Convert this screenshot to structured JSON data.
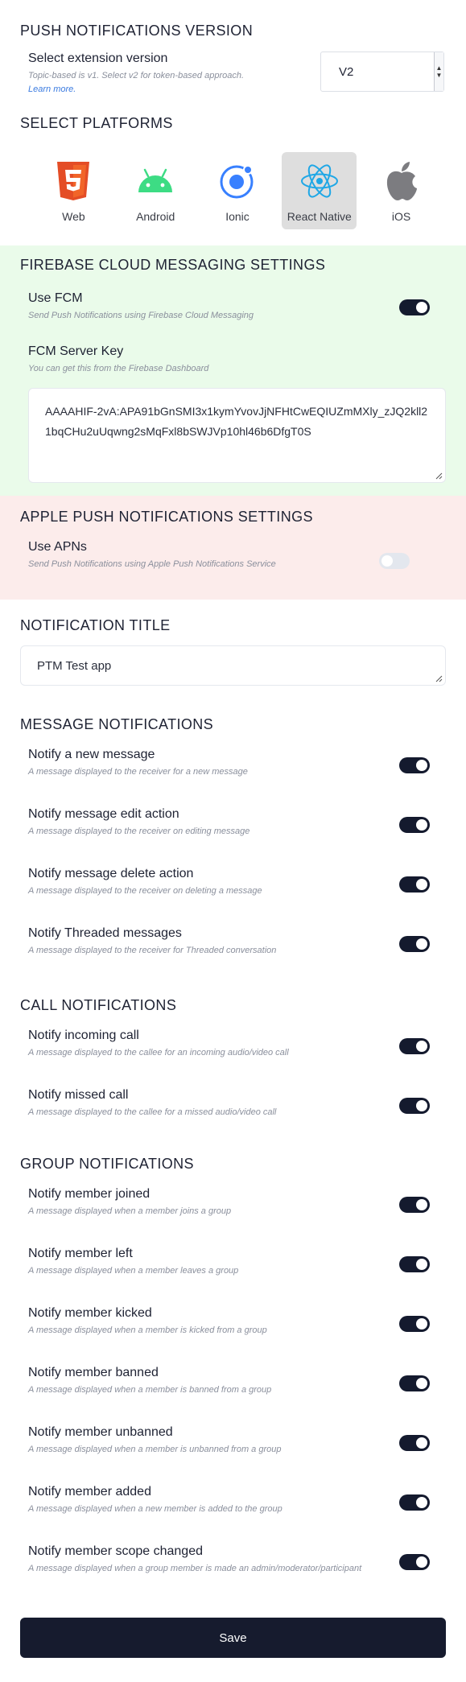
{
  "version": {
    "heading": "PUSH NOTIFICATIONS VERSION",
    "label": "Select extension version",
    "hint": "Topic-based is v1. Select v2 for token-based approach.",
    "learn_more": "Learn more.",
    "selected": "V2"
  },
  "platforms": {
    "heading": "SELECT PLATFORMS",
    "items": [
      {
        "label": "Web",
        "icon": "html5-icon",
        "selected": false
      },
      {
        "label": "Android",
        "icon": "android-icon",
        "selected": false
      },
      {
        "label": "Ionic",
        "icon": "ionic-icon",
        "selected": false
      },
      {
        "label": "React Native",
        "icon": "react-icon",
        "selected": true
      },
      {
        "label": "iOS",
        "icon": "apple-icon",
        "selected": false
      }
    ]
  },
  "fcm": {
    "heading": "FIREBASE CLOUD MESSAGING SETTINGS",
    "use_label": "Use FCM",
    "use_hint": "Send Push Notifications using Firebase Cloud Messaging",
    "use_enabled": true,
    "key_label": "FCM Server Key",
    "key_hint": "You can get this from the Firebase Dashboard",
    "key_value": "AAAAHIF-2vA:APA91bGnSMI3x1kymYvovJjNFHtCwEQIUZmMXly_zJQ2kll21bqCHu2uUqwng2sMqFxl8bSWJVp10hl46b6DfgT0S"
  },
  "apns": {
    "heading": "APPLE PUSH NOTIFICATIONS SETTINGS",
    "use_label": "Use APNs",
    "use_hint": "Send Push Notifications using Apple Push Notifications Service",
    "use_enabled": false
  },
  "notification_title": {
    "heading": "NOTIFICATION TITLE",
    "value": "PTM Test app"
  },
  "message_notifications": {
    "heading": "MESSAGE NOTIFICATIONS",
    "items": [
      {
        "label": "Notify a new message",
        "hint": "A message displayed to the receiver for a new message",
        "enabled": true
      },
      {
        "label": "Notify message edit action",
        "hint": "A message displayed to the receiver on editing message",
        "enabled": true
      },
      {
        "label": "Notify message delete action",
        "hint": "A message displayed to the receiver on deleting a message",
        "enabled": true
      },
      {
        "label": "Notify Threaded messages",
        "hint": "A message displayed to the receiver for Threaded conversation",
        "enabled": true
      }
    ]
  },
  "call_notifications": {
    "heading": "CALL NOTIFICATIONS",
    "items": [
      {
        "label": "Notify incoming call",
        "hint": "A message displayed to the callee for an incoming audio/video call",
        "enabled": true
      },
      {
        "label": "Notify missed call",
        "hint": "A message displayed to the callee for a missed audio/video call",
        "enabled": true
      }
    ]
  },
  "group_notifications": {
    "heading": "GROUP NOTIFICATIONS",
    "items": [
      {
        "label": "Notify member joined",
        "hint": "A message displayed when a member joins a group",
        "enabled": true
      },
      {
        "label": "Notify member left",
        "hint": "A message displayed when a member leaves a group",
        "enabled": true
      },
      {
        "label": "Notify member kicked",
        "hint": "A message displayed when a member is kicked from a group",
        "enabled": true
      },
      {
        "label": "Notify member banned",
        "hint": "A message displayed when a member is banned from a group",
        "enabled": true
      },
      {
        "label": "Notify member unbanned",
        "hint": "A message displayed when a member is unbanned from a group",
        "enabled": true
      },
      {
        "label": "Notify member added",
        "hint": "A message displayed when a new member is added to the group",
        "enabled": true
      },
      {
        "label": "Notify member scope changed",
        "hint": "A message displayed when a group member is made an admin/moderator/participant",
        "enabled": true
      }
    ]
  },
  "save_label": "Save",
  "colors": {
    "primary": "#161b2e",
    "fcm_bg": "#eafbea",
    "apns_bg": "#fceceb",
    "platform_selected_bg": "#dedede",
    "link": "#3b7be0"
  }
}
